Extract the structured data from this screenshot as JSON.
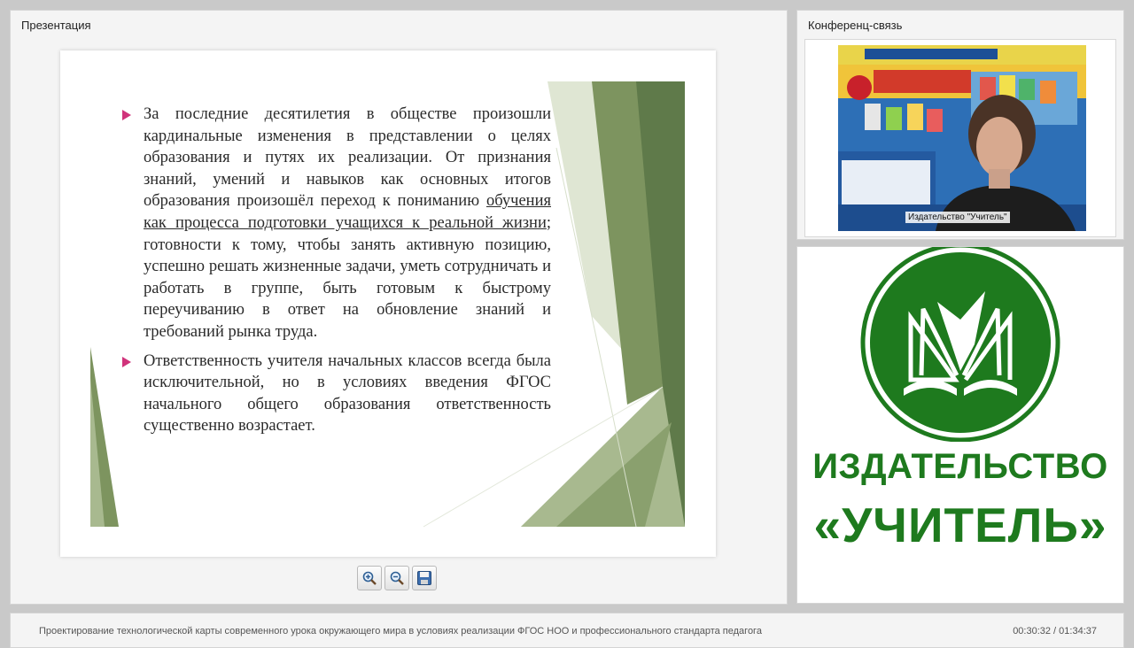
{
  "presentation": {
    "panel_title": "Презентация",
    "slide": {
      "bullets": [
        {
          "before": "За последние десятилетия в обществе произошли кардинальные изменения в представлении о целях образования и путях их реализации. От признания знаний, умений и навыков как основных итогов образования произошёл переход к пониманию ",
          "underlined": "обучения как процесса подготовки учащихся к реальной жизни",
          "after": "; готовности к тому, чтобы занять активную позицию, успешно решать жизненные задачи, уметь сотрудничать и работать в группе, быть готовым к быстрому переучиванию в ответ на обновление знаний и требований рынка труда."
        },
        {
          "before": "Ответственность учителя начальных классов всегда была исключительной, но в условиях введения ФГОС начального общего образования ответственность существенно возрастает.",
          "underlined": "",
          "after": ""
        }
      ]
    },
    "toolbar": {
      "zoom_in_icon": "zoom-in-icon",
      "zoom_out_icon": "zoom-out-icon",
      "save_icon": "save-icon"
    }
  },
  "conference": {
    "panel_title": "Конференц-связь",
    "video_label": "Издательство \"Учитель\""
  },
  "logo": {
    "line1": "ИЗДАТЕЛЬСТВО",
    "line2": "«УЧИТЕЛЬ»",
    "color": "#1e7a1e"
  },
  "footer": {
    "title": "Проектирование технологической карты современного урока окружающего мира в условиях реализации ФГОС НОО и профессионального стандарта педагога",
    "time": "00:30:32 / 01:34:37"
  },
  "colors": {
    "bullet": "#d0337b",
    "slide_green_dark": "#5f7a4a",
    "slide_green_light": "#a8b98f"
  }
}
